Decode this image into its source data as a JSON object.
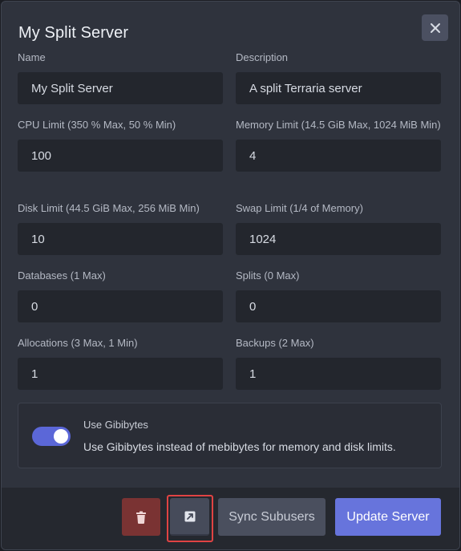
{
  "modal": {
    "title": "My Split Server",
    "close_icon": "close-icon"
  },
  "fields": {
    "name": {
      "label": "Name",
      "value": "My Split Server"
    },
    "description": {
      "label": "Description",
      "value": "A split Terraria server"
    },
    "cpu": {
      "label": "CPU Limit (350 % Max, 50 % Min)",
      "value": "100"
    },
    "memory": {
      "label": "Memory Limit (14.5 GiB Max, 1024 MiB Min)",
      "value": "4"
    },
    "disk": {
      "label": "Disk Limit (44.5 GiB Max, 256 MiB Min)",
      "value": "10"
    },
    "swap": {
      "label": "Swap Limit (1/4 of Memory)",
      "value": "1024"
    },
    "databases": {
      "label": "Databases (1 Max)",
      "value": "0"
    },
    "splits": {
      "label": "Splits (0 Max)",
      "value": "0"
    },
    "allocations": {
      "label": "Allocations (3 Max, 1 Min)",
      "value": "1"
    },
    "backups": {
      "label": "Backups (2 Max)",
      "value": "1"
    }
  },
  "gibibytes": {
    "title": "Use Gibibytes",
    "description": "Use Gibibytes instead of mebibytes for memory and disk limits.",
    "enabled": true
  },
  "footer": {
    "delete_icon": "trash-icon",
    "open_icon": "external-link-icon",
    "sync_label": "Sync Subusers",
    "update_label": "Update Server"
  },
  "colors": {
    "accent": "#6774dc",
    "danger": "#7a3333",
    "highlight": "#e04343"
  }
}
